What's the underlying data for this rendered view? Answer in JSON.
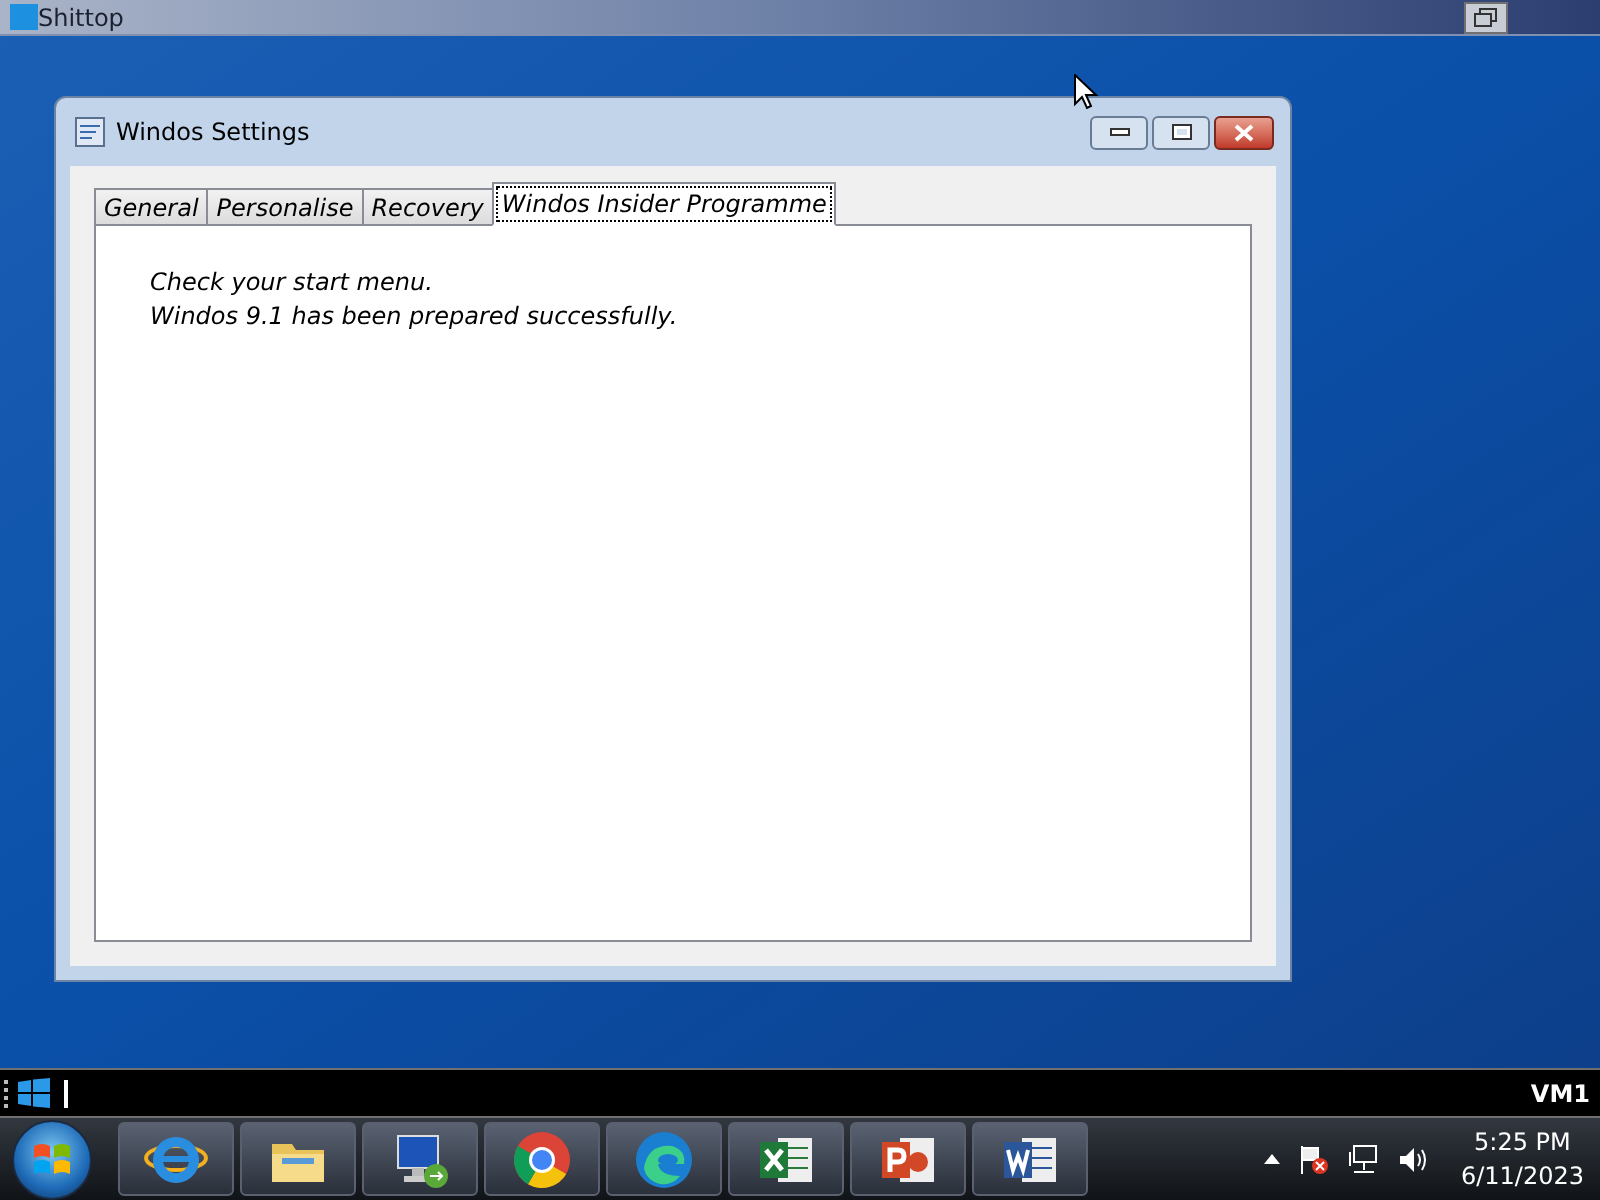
{
  "top_bar": {
    "title": "Shittop"
  },
  "window": {
    "title": "Windos Settings",
    "tabs": [
      {
        "label": "General",
        "selected": false
      },
      {
        "label": "Personalise",
        "selected": false
      },
      {
        "label": "Recovery",
        "selected": false
      },
      {
        "label": "Windos Insider Programme",
        "selected": true
      }
    ],
    "content": [
      "Check your start menu.",
      "Windos 9.1 has been prepared successfully."
    ]
  },
  "command_bar": {
    "label": "VM1"
  },
  "taskbar": {
    "apps": [
      {
        "kind": "browser-e"
      },
      {
        "kind": "folder"
      },
      {
        "kind": "computer"
      },
      {
        "kind": "chrome"
      },
      {
        "kind": "edge"
      },
      {
        "kind": "sheet"
      },
      {
        "kind": "slides"
      },
      {
        "kind": "doc"
      }
    ],
    "clock": {
      "time": "5:25 PM",
      "date": "6/11/2023"
    }
  }
}
